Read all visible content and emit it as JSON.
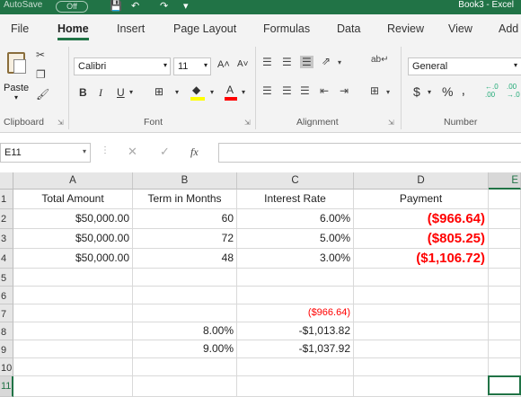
{
  "titlebar": {
    "autosave_label": "AutoSave",
    "autosave_state": "Off",
    "window_title": "Book3 - Excel"
  },
  "ribbon_tabs": [
    "File",
    "Home",
    "Insert",
    "Page Layout",
    "Formulas",
    "Data",
    "Review",
    "View",
    "Add"
  ],
  "clipboard": {
    "paste_label": "Paste",
    "group_label": "Clipboard"
  },
  "font": {
    "name": "Calibri",
    "size": "11",
    "group_label": "Font"
  },
  "alignment": {
    "group_label": "Alignment"
  },
  "number": {
    "format": "General",
    "group_label": "Number",
    "currency_symbol": "$",
    "percent_symbol": "%"
  },
  "formula_bar": {
    "name_box": "E11",
    "fx_symbol": "fx",
    "formula": ""
  },
  "sheet": {
    "columns": [
      "A",
      "B",
      "C",
      "D",
      "E"
    ],
    "rows": [
      "1",
      "2",
      "3",
      "4",
      "5",
      "6",
      "7",
      "8",
      "9",
      "10",
      "11"
    ],
    "headers": {
      "a1": "Total Amount",
      "b1": "Term in Months",
      "c1": "Interest Rate",
      "d1": "Payment"
    },
    "r2": {
      "a": "$50,000.00",
      "b": "60",
      "c": "6.00%",
      "d": "($966.64)"
    },
    "r3": {
      "a": "$50,000.00",
      "b": "72",
      "c": "5.00%",
      "d": "($805.25)"
    },
    "r4": {
      "a": "$50,000.00",
      "b": "48",
      "c": "3.00%",
      "d": "($1,106.72)"
    },
    "r7": {
      "c": "($966.64)"
    },
    "r8": {
      "b": "8.00%",
      "c": "-$1,013.82"
    },
    "r9": {
      "b": "9.00%",
      "c": "-$1,037.92"
    },
    "selected_cell": "E11"
  },
  "colors": {
    "accent": "#217346",
    "negative": "#ff0000",
    "header_fill": "#e6e6e6",
    "gridline": "#d9d9d9"
  }
}
